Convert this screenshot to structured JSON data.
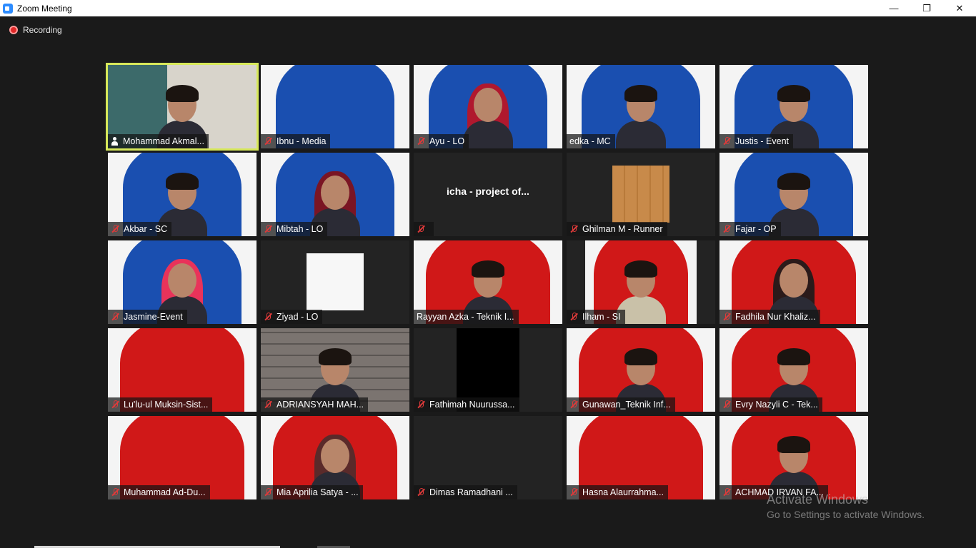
{
  "window": {
    "title": "Zoom Meeting",
    "controls": {
      "minimize": "—",
      "restore": "❐",
      "close": "✕"
    }
  },
  "recording": {
    "label": "Recording"
  },
  "participants": [
    {
      "name": "Mohammad Akmal...",
      "icon": "person-icon",
      "bg": "room"
    },
    {
      "name": "Ibnu - Media",
      "icon": "mic-muted-icon",
      "bg": "blue"
    },
    {
      "name": "Ayu - LO",
      "icon": "mic-muted-icon",
      "bg": "blue"
    },
    {
      "name": "edka - MC",
      "icon": "",
      "bg": "blue"
    },
    {
      "name": "Justis - Event",
      "icon": "mic-muted-icon",
      "bg": "blue"
    },
    {
      "name": "Akbar - SC",
      "icon": "mic-muted-icon",
      "bg": "blue"
    },
    {
      "name": "Mibtah - LO",
      "icon": "mic-muted-icon",
      "bg": "blue"
    },
    {
      "name": "",
      "center_name": "icha - project of...",
      "icon": "mic-muted-icon",
      "bg": "dark"
    },
    {
      "name": "Ghilman M - Runner",
      "icon": "mic-muted-icon",
      "bg": "dark-inset"
    },
    {
      "name": "Fajar - OP",
      "icon": "mic-muted-icon",
      "bg": "blue"
    },
    {
      "name": "Jasmine-Event",
      "icon": "mic-muted-icon",
      "bg": "blue"
    },
    {
      "name": "Ziyad - LO",
      "icon": "mic-muted-icon",
      "bg": "dark-white"
    },
    {
      "name": "Rayyan Azka - Teknik I...",
      "icon": "",
      "bg": "red"
    },
    {
      "name": "Ilham - SI",
      "icon": "mic-muted-icon",
      "bg": "red-inset"
    },
    {
      "name": "Fadhila Nur Khaliz...",
      "icon": "mic-muted-icon",
      "bg": "red"
    },
    {
      "name": "Lu'lu-ul Muksin-Sist...",
      "icon": "mic-muted-icon",
      "bg": "red"
    },
    {
      "name": "ADRIANSYAH MAH...",
      "icon": "mic-muted-icon",
      "bg": "bricks"
    },
    {
      "name": "Fathimah Nuurussa...",
      "icon": "mic-muted-icon",
      "bg": "dark-black"
    },
    {
      "name": "Gunawan_Teknik Inf...",
      "icon": "mic-muted-icon",
      "bg": "red"
    },
    {
      "name": "Evry Nazyli C - Tek...",
      "icon": "mic-muted-icon",
      "bg": "red"
    },
    {
      "name": "Muhammad Ad-Du...",
      "icon": "mic-muted-icon",
      "bg": "red"
    },
    {
      "name": "Mia Aprilia Satya - ...",
      "icon": "mic-muted-icon",
      "bg": "red"
    },
    {
      "name": "Dimas Ramadhani ...",
      "icon": "mic-muted-icon",
      "bg": "dark"
    },
    {
      "name": "Hasna Alaurrahma...",
      "icon": "mic-muted-icon",
      "bg": "red"
    },
    {
      "name": "ACHMAD IRVAN FA...",
      "icon": "mic-muted-icon",
      "bg": "red"
    }
  ],
  "watermark": {
    "line1": "Activate Windows",
    "line2": "Go to Settings to activate Windows."
  },
  "colors": {
    "active_speaker_border": "#d7e85a",
    "blue_bg": "#1a4fb0",
    "red_bg": "#d01818",
    "muted_icon": "#e03a3a"
  }
}
